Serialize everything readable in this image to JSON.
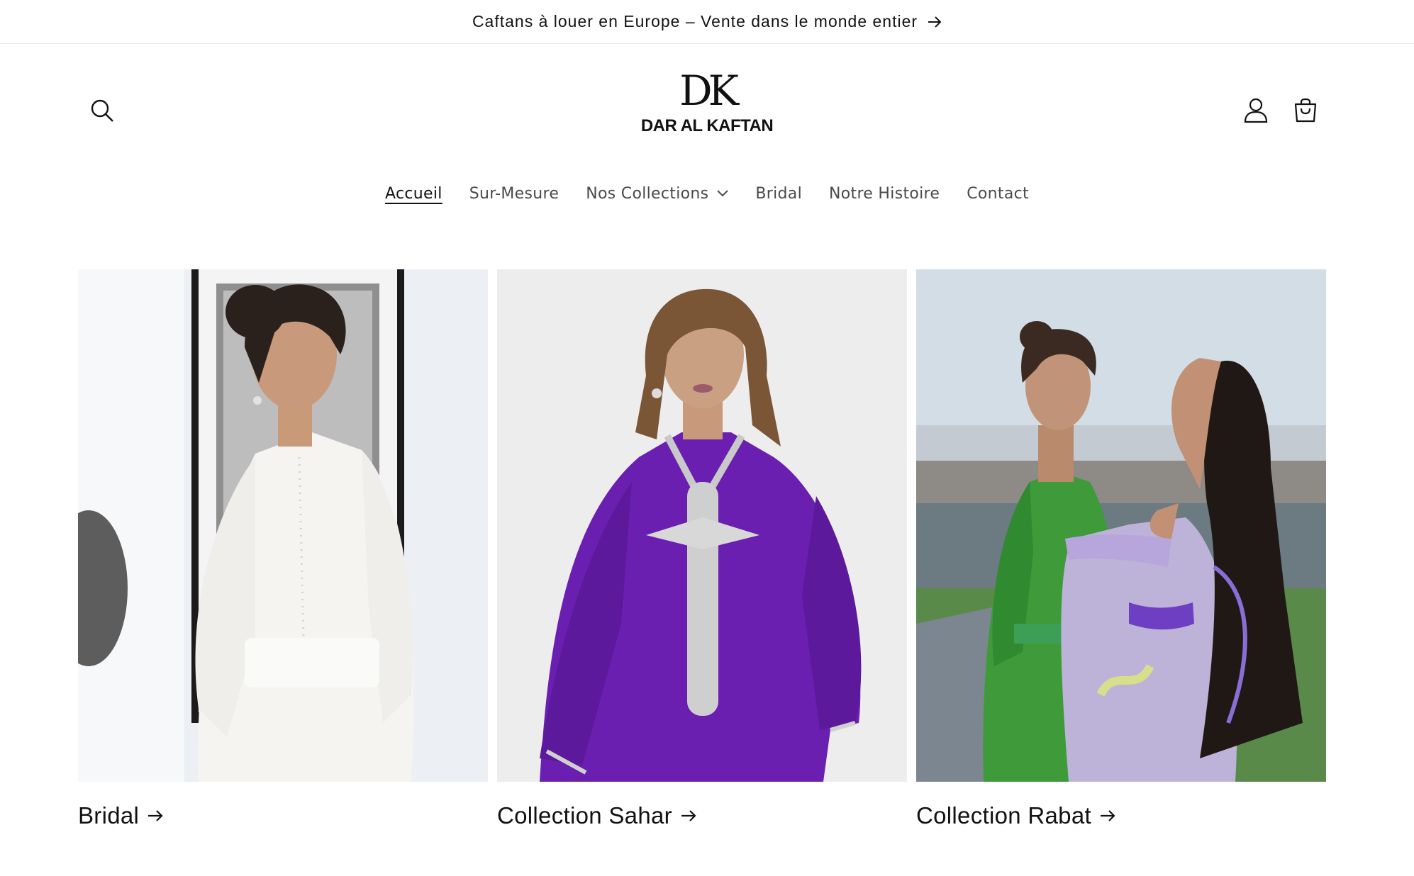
{
  "announcement": {
    "text": "Caftans à louer en Europe – Vente dans le monde entier",
    "icon": "arrow-right-icon"
  },
  "header": {
    "search_icon": "search-icon",
    "account_icon": "user-icon",
    "cart_icon": "shopping-bag-icon",
    "logo": {
      "mark": "DK",
      "text": "DAR AL KAFTAN"
    }
  },
  "nav": {
    "items": [
      {
        "label": "Accueil",
        "active": true
      },
      {
        "label": "Sur-Mesure"
      },
      {
        "label": "Nos Collections",
        "has_dropdown": true
      },
      {
        "label": "Bridal"
      },
      {
        "label": "Notre Histoire"
      },
      {
        "label": "Contact"
      }
    ]
  },
  "collections": [
    {
      "title": "Bridal",
      "colors": {
        "dress": "#f3f1ed",
        "background": "#e9ecef"
      }
    },
    {
      "title": "Collection Sahar",
      "colors": {
        "dress": "#6a1fb0",
        "background": "#ededee"
      }
    },
    {
      "title": "Collection Rabat",
      "colors": {
        "dress_left": "#3f9a3a",
        "dress_right": "#b9aadb",
        "background": "#cfd9e3"
      }
    }
  ],
  "colors": {
    "text": "#121212",
    "nav_text": "#4a4a4a",
    "divider": "#e8e8e8",
    "background": "#ffffff"
  }
}
